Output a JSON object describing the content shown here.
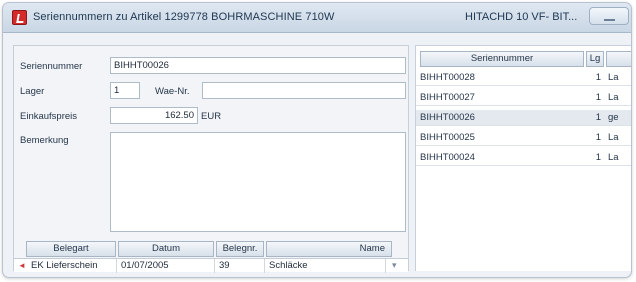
{
  "window": {
    "title": "Seriennummern zu Artikel 1299778 BOHRMASCHINE 710W",
    "title_right": "HITACHD 10 VF- BIT..."
  },
  "form": {
    "serial_label": "Seriennummer",
    "serial_value": "BIHHT00026",
    "lager_label": "Lager",
    "lager_value": "1",
    "wareneingang_label": "Wae-Nr.",
    "wareneingang_value": "",
    "purchase_price_label": "Einkaufspreis",
    "purchase_price_value": "162.50",
    "currency": "EUR",
    "remark_label": "Bemerkung",
    "remark_value": ""
  },
  "bottom_grid": {
    "columns": [
      "Belegart",
      "Datum",
      "Belegnr.",
      "Name"
    ],
    "rows": [
      {
        "belegart": "EK Lieferschein",
        "datum": "01/07/2005",
        "belegnr": "39",
        "name": "Schläcke"
      }
    ]
  },
  "serial_grid": {
    "columns": [
      "Seriennummer",
      "Lg",
      ""
    ],
    "rows": [
      {
        "serial": "BIHHT00028",
        "lg": "1",
        "status": "La"
      },
      {
        "serial": "BIHHT00027",
        "lg": "1",
        "status": "La"
      },
      {
        "serial": "BIHHT00026",
        "lg": "1",
        "status": "ge"
      },
      {
        "serial": "BIHHT00025",
        "lg": "1",
        "status": "La"
      },
      {
        "serial": "BIHHT00024",
        "lg": "1",
        "status": "La"
      }
    ],
    "selected_index": 2
  },
  "colors": {
    "accent": "#d42a2a",
    "titlebar": "#c9d6e4"
  }
}
